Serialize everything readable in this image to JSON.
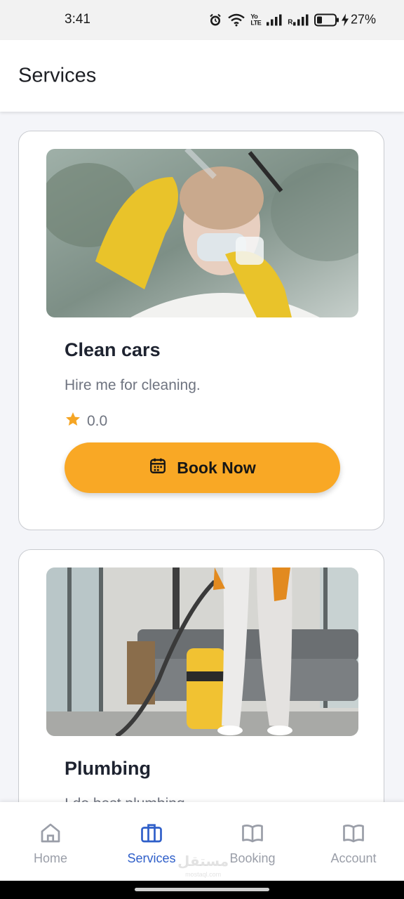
{
  "status_bar": {
    "time": "3:41",
    "volte_top": "Yo",
    "volte_bottom": "LTE",
    "roaming": "R",
    "battery": "27%",
    "icons": [
      "alarm-icon",
      "wifi-icon",
      "signal-icon",
      "battery-icon",
      "charging-icon"
    ]
  },
  "app_bar": {
    "title": "Services"
  },
  "services": [
    {
      "title": "Clean cars",
      "description": "Hire me for cleaning.",
      "rating": "0.0",
      "button_label": "Book Now",
      "image": "person-cleaning-window-photo"
    },
    {
      "title": "Plumbing",
      "description": "I do best plumbing",
      "image": "person-vacuuming-living-room-photo"
    }
  ],
  "bottom_nav": {
    "active": "Services",
    "items": [
      {
        "label": "Home",
        "icon": "home-icon"
      },
      {
        "label": "Services",
        "icon": "briefcase-icon"
      },
      {
        "label": "Booking",
        "icon": "book-icon"
      },
      {
        "label": "Account",
        "icon": "book-icon"
      }
    ]
  },
  "watermark": {
    "main": "مستقل",
    "sub": "mostaql.com"
  },
  "colors": {
    "accent": "#f9a825",
    "nav_active": "#2f5fc9",
    "nav_inactive": "#9a9ea8",
    "star": "#f5a524"
  }
}
